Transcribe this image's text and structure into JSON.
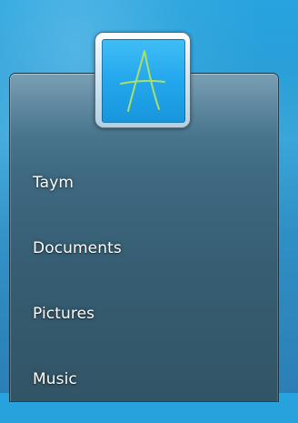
{
  "start_menu": {
    "user_picture": {
      "icon": "letter-a-avatar-icon",
      "glyph_color": "#a8e06a",
      "tile_color": "#2aa8ea"
    },
    "items": [
      {
        "label": "Taym"
      },
      {
        "label": "Documents"
      },
      {
        "label": "Pictures"
      },
      {
        "label": "Music"
      }
    ]
  }
}
